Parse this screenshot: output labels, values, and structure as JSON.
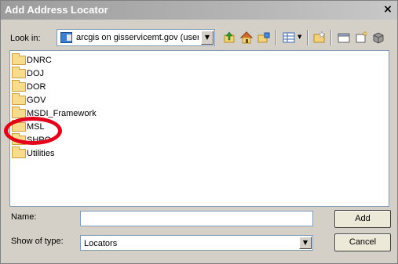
{
  "window": {
    "title": "Add Address Locator",
    "close_glyph": "×"
  },
  "look_in": {
    "label": "Look in:",
    "value": "arcgis on gisservicemt.gov (user"
  },
  "toolbar": {
    "icons": [
      "up-one-level-icon",
      "home-icon",
      "connect-folder-icon",
      "view-menu-icon",
      "new-folder-icon",
      "folder-options-icon",
      "new-item-icon",
      "catalog-icon"
    ]
  },
  "file_list": {
    "items": [
      {
        "label": "DNRC"
      },
      {
        "label": "DOJ"
      },
      {
        "label": "DOR"
      },
      {
        "label": "GOV"
      },
      {
        "label": "MSDI_Framework"
      },
      {
        "label": "MSL"
      },
      {
        "label": "SHPO"
      },
      {
        "label": "Utilities"
      }
    ],
    "highlighted_item": "MSL",
    "highlight_color": "#e2001a"
  },
  "name_field": {
    "label": "Name:",
    "value": ""
  },
  "type_field": {
    "label": "Show of type:",
    "value": "Locators"
  },
  "buttons": {
    "add": "Add",
    "cancel": "Cancel"
  }
}
